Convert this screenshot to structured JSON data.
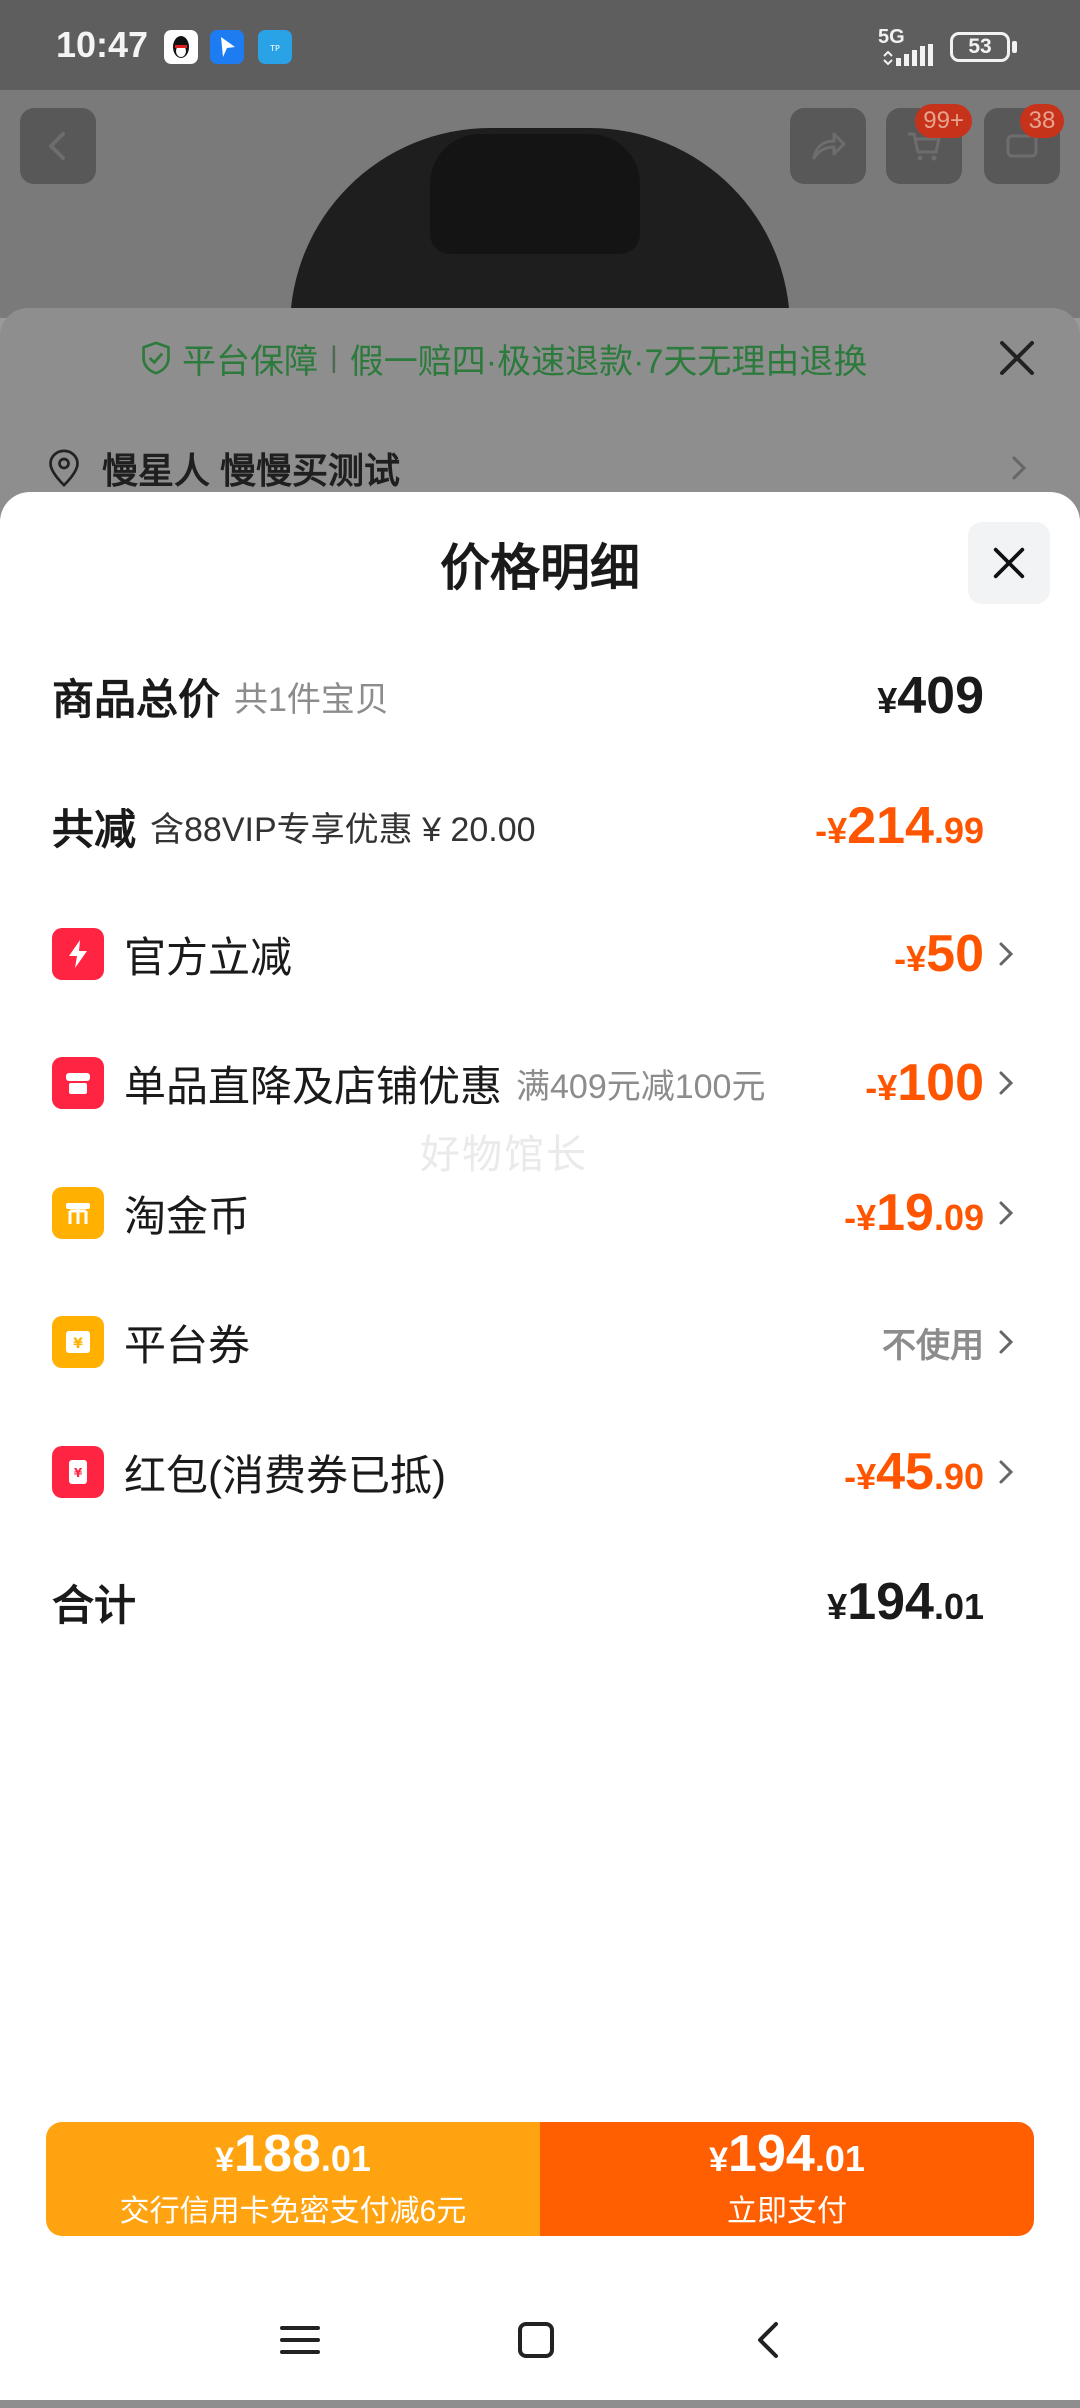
{
  "status_bar": {
    "time": "10:47",
    "network": "5G",
    "battery": "53"
  },
  "background_page": {
    "cart_badge": "99+",
    "message_badge": "38",
    "guarantee": {
      "title": "平台保障",
      "items": "假一赔四·极速退款·7天无理由退换"
    },
    "address": "慢星人 慢慢买测试"
  },
  "price_sheet": {
    "title": "价格明细",
    "total": {
      "label": "商品总价",
      "sub": "共1件宝贝",
      "symbol": "¥",
      "int": "409",
      "dec": ""
    },
    "discount": {
      "label": "共减",
      "sub": "含88VIP专享优惠 ¥ 20.00",
      "symbol": "-¥",
      "int": "214",
      "dec": ".99"
    },
    "items": [
      {
        "label": "官方立减",
        "sub": "",
        "symbol": "-¥",
        "int": "50",
        "dec": "",
        "icon": "lightning-icon",
        "color": "#ff2442"
      },
      {
        "label": "单品直降及店铺优惠",
        "sub": "满409元减100元",
        "symbol": "-¥",
        "int": "100",
        "dec": "",
        "icon": "shop-icon",
        "color": "#ff2442"
      },
      {
        "label": "淘金币",
        "sub": "",
        "symbol": "-¥",
        "int": "19",
        "dec": ".09",
        "icon": "coin-icon",
        "color": "#ffb000"
      },
      {
        "label": "平台券",
        "sub": "",
        "status": "不使用",
        "icon": "coupon-icon",
        "color": "#ffb000"
      },
      {
        "label": "红包(消费券已抵)",
        "sub": "",
        "symbol": "-¥",
        "int": "45",
        "dec": ".90",
        "icon": "red-packet-icon",
        "color": "#ff2442"
      }
    ],
    "sum": {
      "label": "合计",
      "symbol": "¥",
      "int": "194",
      "dec": ".01"
    },
    "watermark": "好物馆长"
  },
  "pay": {
    "card": {
      "symbol": "¥",
      "int": "188",
      "dec": ".01",
      "label": "交行信用卡免密支付减6元"
    },
    "now": {
      "symbol": "¥",
      "int": "194",
      "dec": ".01",
      "label": "立即支付"
    }
  },
  "colors": {
    "accent_orange": "#ff5500",
    "pay_left": "#ffa310",
    "pay_right": "#ff5f00",
    "guarantee_green": "#2c7a3c"
  }
}
